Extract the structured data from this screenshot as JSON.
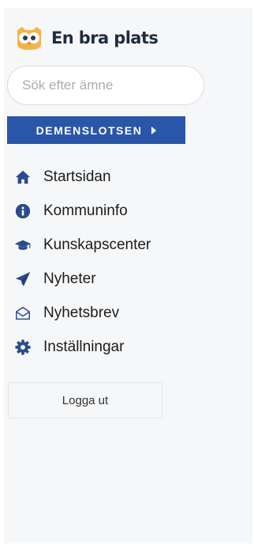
{
  "brand": {
    "name": "En bra plats",
    "logo_icon": "owl-icon"
  },
  "search": {
    "placeholder": "Sök efter ämne"
  },
  "banner": {
    "label": "DEMENSLOTSEN",
    "icon": "chevron-right-icon"
  },
  "menu": {
    "items": [
      {
        "label": "Startsidan",
        "icon": "home-icon"
      },
      {
        "label": "Kommuninfo",
        "icon": "info-icon"
      },
      {
        "label": "Kunskapscenter",
        "icon": "graduation-cap-icon"
      },
      {
        "label": "Nyheter",
        "icon": "paper-plane-icon"
      },
      {
        "label": "Nyhetsbrev",
        "icon": "envelope-icon"
      },
      {
        "label": "Inställningar",
        "icon": "gear-icon"
      }
    ]
  },
  "logout": {
    "label": "Logga ut"
  },
  "colors": {
    "accent": "#2a56aa",
    "icon": "#2b4c8c",
    "logo_orange": "#f2b34a",
    "text": "#1c1c1c",
    "sidebar_bg": "#f6f7f9"
  }
}
